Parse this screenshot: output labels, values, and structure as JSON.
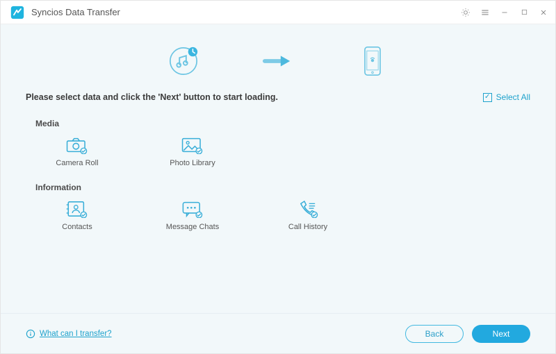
{
  "app": {
    "title": "Syncios Data Transfer"
  },
  "instruction": "Please select data and click the 'Next' button to start loading.",
  "select_all_label": "Select All",
  "sections": {
    "media": {
      "title": "Media",
      "camera_roll": "Camera Roll",
      "photo_library": "Photo Library"
    },
    "information": {
      "title": "Information",
      "contacts": "Contacts",
      "message_chats": "Message Chats",
      "call_history": "Call History"
    }
  },
  "footer": {
    "help_text": "What can I transfer?",
    "back": "Back",
    "next": "Next"
  },
  "colors": {
    "accent": "#22a9df"
  }
}
